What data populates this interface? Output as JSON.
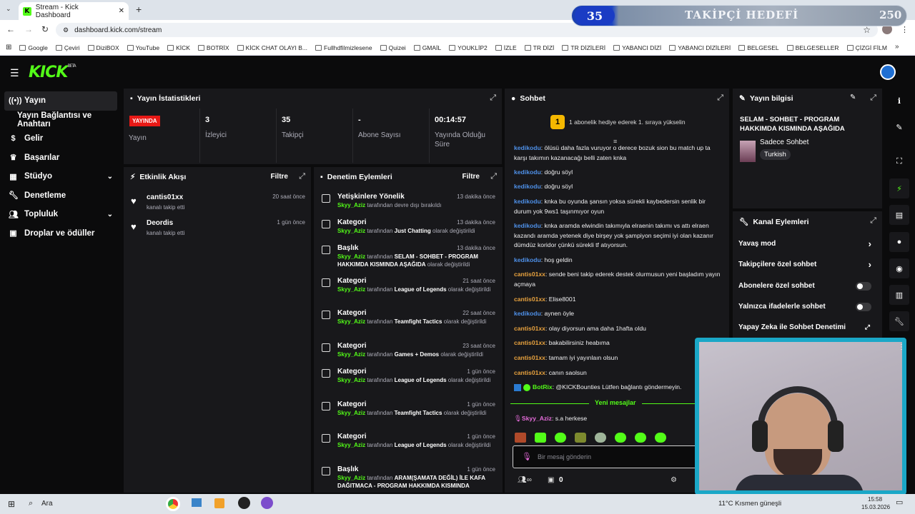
{
  "browser": {
    "tab_title": "Stream - Kick Dashboard",
    "url": "dashboard.kick.com/stream",
    "bookmarks": [
      "Google",
      "Çeviri",
      "DiziBOX",
      "YouTube",
      "KİCK",
      "BOTRİX",
      "KİCK CHAT OLAYI B...",
      "Fullhdfilmizlesene",
      "Quizei",
      "GMAİL",
      "YOUKLİP2",
      "İZLE",
      "TR DİZİ",
      "TR DİZİLERİ",
      "YABANCI DİZİ",
      "YABANCI DİZİLERİ",
      "BELGESEL",
      "BELGESELLER",
      "ÇİZGİ FİLM"
    ]
  },
  "kick": {
    "logo": "KICK",
    "beta": "BETA"
  },
  "sidebar": {
    "items": [
      {
        "label": "Yayın",
        "icon": "broadcast-icon",
        "active": true
      },
      {
        "label": "Yayın Bağlantısı ve Anahtarı",
        "icon": ""
      },
      {
        "label": "Gelir",
        "icon": "dollar-icon"
      },
      {
        "label": "Başarılar",
        "icon": "trophy-icon"
      },
      {
        "label": "Stüdyo",
        "icon": "grid-icon",
        "chevron": true
      },
      {
        "label": "Denetleme",
        "icon": "wrench-icon"
      },
      {
        "label": "Topluluk",
        "icon": "users-icon",
        "chevron": true
      },
      {
        "label": "Droplar ve ödüller",
        "icon": "gift-icon"
      }
    ]
  },
  "stats": {
    "title": "Yayın İstatistikleri",
    "live_badge": "YAYINDA",
    "live_label": "Yayın",
    "viewers": {
      "value": "3",
      "label": "İzleyici"
    },
    "followers": {
      "value": "35",
      "label": "Takipçi"
    },
    "subs": {
      "value": "-",
      "label": "Abone Sayısı"
    },
    "uptime": {
      "value": "00:14:57",
      "label": "Yayında Olduğu Süre"
    }
  },
  "activity": {
    "title": "Etkinlik Akışı",
    "filter": "Filtre",
    "events": [
      {
        "name": "cantis01xx",
        "sub": "kanalı takip etti",
        "time": "20 saat önce"
      },
      {
        "name": "Deordis",
        "sub": "kanalı takip etti",
        "time": "1 gün önce"
      }
    ]
  },
  "moderation": {
    "title": "Denetim Eylemleri",
    "filter": "Filtre",
    "items": [
      {
        "title": "Yetişkinlere Yönelik",
        "user": "Skyy_Aziz",
        "mid": " tarafından devre dışı bırakıldı",
        "value": "",
        "tail": "",
        "time": "13 dakika önce"
      },
      {
        "title": "Kategori",
        "user": "Skyy_Aziz",
        "mid": " tarafından ",
        "value": "Just Chatting",
        "tail": " olarak değiştirildi",
        "time": "13 dakika önce"
      },
      {
        "title": "Başlık",
        "user": "Skyy_Aziz",
        "mid": " tarafından ",
        "value": "SELAM - SOHBET - PROGRAM HAKKIMDA KISMINDA AŞAĞIDA",
        "tail": " olarak değiştirildi",
        "time": "13 dakika önce"
      },
      {
        "title": "Kategori",
        "user": "Skyy_Aziz",
        "mid": " tarafından ",
        "value": "League of Legends",
        "tail": " olarak değiştirildi",
        "time": "21 saat önce"
      },
      {
        "title": "Kategori",
        "user": "Skyy_Aziz",
        "mid": " tarafından ",
        "value": "Teamfight Tactics",
        "tail": " olarak değiştirildi",
        "time": "22 saat önce"
      },
      {
        "title": "Kategori",
        "user": "Skyy_Aziz",
        "mid": " tarafından ",
        "value": "Games + Demos",
        "tail": " olarak değiştirildi",
        "time": "23 saat önce"
      },
      {
        "title": "Kategori",
        "user": "Skyy_Aziz",
        "mid": " tarafından ",
        "value": "League of Legends",
        "tail": " olarak değiştirildi",
        "time": "1 gün önce"
      },
      {
        "title": "Kategori",
        "user": "Skyy_Aziz",
        "mid": " tarafından ",
        "value": "Teamfight Tactics",
        "tail": " olarak değiştirildi",
        "time": "1 gün önce"
      },
      {
        "title": "Kategori",
        "user": "Skyy_Aziz",
        "mid": " tarafından ",
        "value": "League of Legends",
        "tail": " olarak değiştirildi",
        "time": "1 gün önce"
      },
      {
        "title": "Başlık",
        "user": "Skyy_Aziz",
        "mid": " tarafından ",
        "value": "ARAM(ŞAMATA DEĞİL) İLE KAFA DAĞITMACA - PROGRAM HAKKIMDA KISMINDA",
        "tail": "",
        "time": "1 gün önce"
      }
    ]
  },
  "chat": {
    "title": "Sohbet",
    "promo": "1 abonelik hediye ederek 1. sıraya yükselin",
    "promo_rank": "1",
    "messages": [
      {
        "user": "kedikodu",
        "color": "blue",
        "text": "ölüsü daha fazla vuruyor o derece bozuk sion bu match up ta karşı takımın kazanacağı belli zaten knka"
      },
      {
        "user": "kedikodu",
        "color": "blue",
        "text": "doğru söyl"
      },
      {
        "user": "kedikodu",
        "color": "blue",
        "text": "doğru söyl"
      },
      {
        "user": "kedikodu",
        "color": "blue",
        "text": "knka bu oyunda şansın yoksa sürekli kaybedersin senlik bir durum yok 9ws1 taşınmıyor oyun"
      },
      {
        "user": "kedikodu",
        "color": "blue",
        "text": "knka aramda elwindin takımıyla elraenin takımı vs attı elraen kazandı aramda yetenek diye birşey yok şampiyon seçimi iyi olan kazanır dümdüz koridor çünkü sürekli tf atıyorsun."
      },
      {
        "user": "kedikodu",
        "color": "blue",
        "text": "hoş geldin"
      },
      {
        "user": "cantis01xx",
        "color": "orange",
        "text": "sende beni takip ederek destek olurmusun yeni başladım yayın açmaya"
      },
      {
        "user": "cantis01xx",
        "color": "orange",
        "text": "Elise8001"
      },
      {
        "user": "kedikodu",
        "color": "blue",
        "text": "aynen öyle"
      },
      {
        "user": "cantis01xx",
        "color": "orange",
        "text": "olay diyorsun ama daha 1hafta oldu"
      },
      {
        "user": "cantis01xx",
        "color": "orange",
        "text": "bakabilirsiniz heabıma"
      },
      {
        "user": "cantis01xx",
        "color": "orange",
        "text": "tamam iyi yayınlaın olsun"
      },
      {
        "user": "cantis01xx",
        "color": "orange",
        "text": "canın saolsun"
      },
      {
        "user": "BotRix",
        "color": "green",
        "text": "@KICKBounties Lütfen bağlantı göndermeyin."
      }
    ],
    "new_messages": "Yeni mesajlar",
    "last": {
      "user": "Skyy_Aziz",
      "text": "s.a herkese"
    },
    "placeholder": "Bir mesaj gönderin",
    "footer_count": "0"
  },
  "info": {
    "title": "Yayın bilgisi",
    "stream_title": "SELAM - SOHBET - PROGRAM HAKKIMDA KISMINDA AŞAĞIDA",
    "category": "Sadece Sohbet",
    "language": "Turkish"
  },
  "actions": {
    "title": "Kanal Eylemleri",
    "items": [
      {
        "label": "Yavaş mod",
        "type": "chevron"
      },
      {
        "label": "Takipçilere özel sohbet",
        "type": "chevron"
      },
      {
        "label": "Abonelere özel sohbet",
        "type": "toggle"
      },
      {
        "label": "Yalnızca ifadelerle sohbet",
        "type": "toggle"
      },
      {
        "label": "Yapay Zeka ile Sohbet Denetimi",
        "type": "link"
      }
    ]
  },
  "overlay": {
    "goal_current": "35",
    "goal_title": "TAKİPÇİ HEDEFİ",
    "goal_max": "250"
  },
  "taskbar": {
    "search": "Ara",
    "weather": "11°C  Kısmen güneşli",
    "time": "15:58",
    "date": "15.03.2026"
  },
  "colors": {
    "accent": "#53fc18",
    "panel": "#18181b",
    "live": "#e91916"
  }
}
